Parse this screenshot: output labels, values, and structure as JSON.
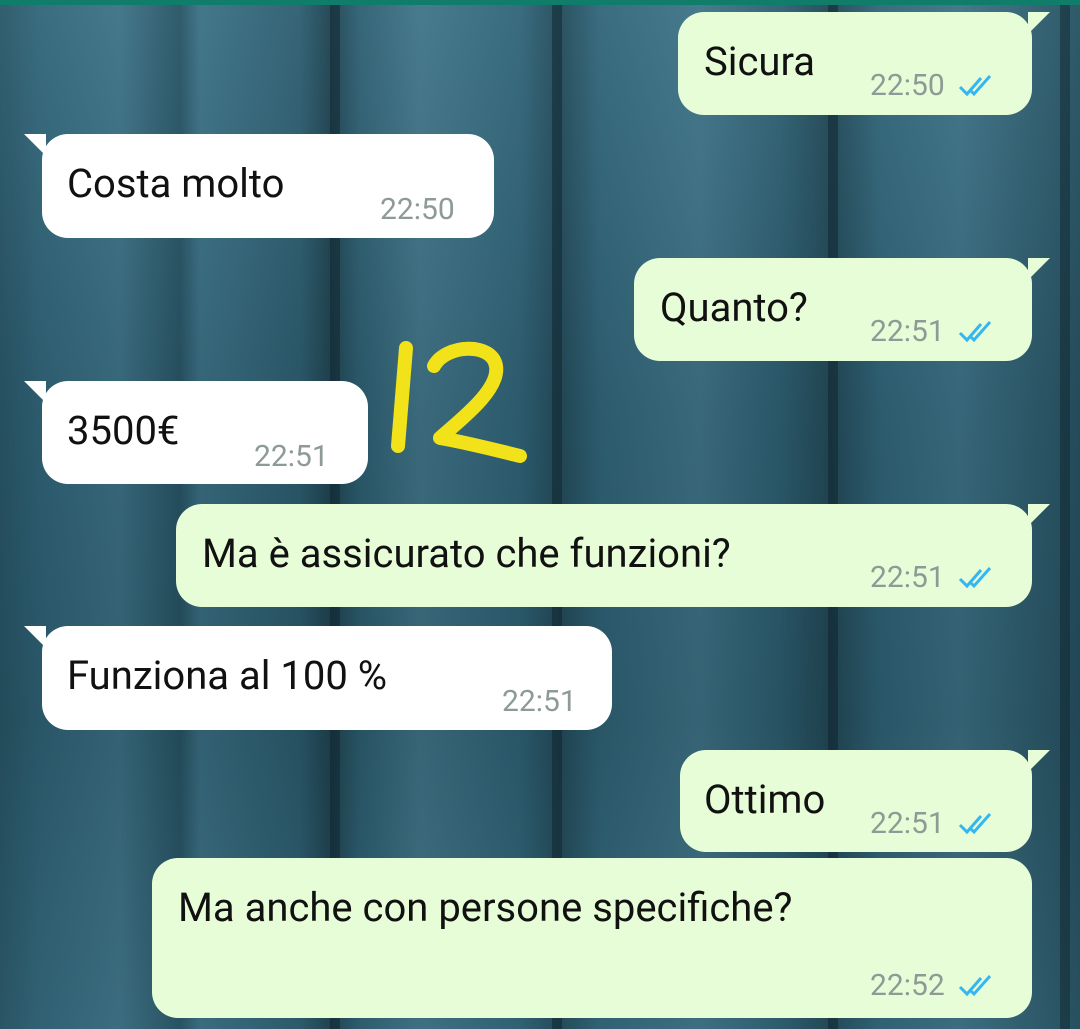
{
  "chat": {
    "messages": [
      {
        "direction": "out",
        "text": "Sicura",
        "time": "22:50",
        "status": "read"
      },
      {
        "direction": "in",
        "text": "Costa molto",
        "time": "22:50"
      },
      {
        "direction": "out",
        "text": "Quanto?",
        "time": "22:51",
        "status": "read"
      },
      {
        "direction": "in",
        "text": "3500€",
        "time": "22:51"
      },
      {
        "direction": "out",
        "text": "Ma è assicurato che funzioni?",
        "time": "22:51",
        "status": "read"
      },
      {
        "direction": "in",
        "text": "Funziona al 100 %",
        "time": "22:51"
      },
      {
        "direction": "out",
        "text": "Ottimo",
        "time": "22:51",
        "status": "read"
      },
      {
        "direction": "out",
        "text": "Ma anche con persone specifiche?",
        "time": "22:52",
        "status": "read"
      }
    ]
  },
  "annotation": {
    "text": "12",
    "color": "#f2e21a"
  },
  "colors": {
    "outgoing_bubble": "#e7fdd7",
    "incoming_bubble": "#ffffff",
    "read_ticks": "#34b7f1",
    "header_accent": "#0f7d69"
  },
  "icons": {
    "read_status": "double-check-icon"
  }
}
